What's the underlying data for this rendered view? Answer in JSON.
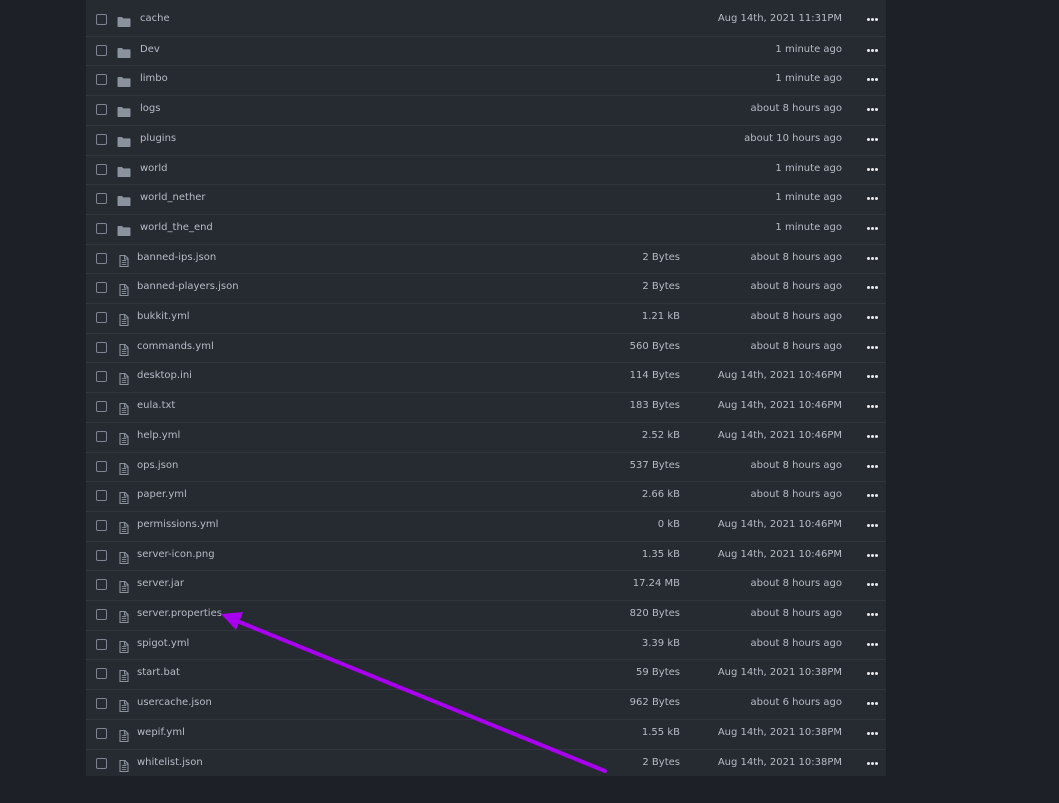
{
  "files": [
    {
      "type": "folder",
      "name": "cache",
      "size": "",
      "modified": "Aug 14th, 2021 11:31PM"
    },
    {
      "type": "folder",
      "name": "Dev",
      "size": "",
      "modified": "1 minute ago"
    },
    {
      "type": "folder",
      "name": "limbo",
      "size": "",
      "modified": "1 minute ago"
    },
    {
      "type": "folder",
      "name": "logs",
      "size": "",
      "modified": "about 8 hours ago"
    },
    {
      "type": "folder",
      "name": "plugins",
      "size": "",
      "modified": "about 10 hours ago"
    },
    {
      "type": "folder",
      "name": "world",
      "size": "",
      "modified": "1 minute ago"
    },
    {
      "type": "folder",
      "name": "world_nether",
      "size": "",
      "modified": "1 minute ago"
    },
    {
      "type": "folder",
      "name": "world_the_end",
      "size": "",
      "modified": "1 minute ago"
    },
    {
      "type": "file",
      "name": "banned-ips.json",
      "size": "2 Bytes",
      "modified": "about 8 hours ago"
    },
    {
      "type": "file",
      "name": "banned-players.json",
      "size": "2 Bytes",
      "modified": "about 8 hours ago"
    },
    {
      "type": "file",
      "name": "bukkit.yml",
      "size": "1.21 kB",
      "modified": "about 8 hours ago"
    },
    {
      "type": "file",
      "name": "commands.yml",
      "size": "560 Bytes",
      "modified": "about 8 hours ago"
    },
    {
      "type": "file",
      "name": "desktop.ini",
      "size": "114 Bytes",
      "modified": "Aug 14th, 2021 10:46PM"
    },
    {
      "type": "file",
      "name": "eula.txt",
      "size": "183 Bytes",
      "modified": "Aug 14th, 2021 10:46PM"
    },
    {
      "type": "file",
      "name": "help.yml",
      "size": "2.52 kB",
      "modified": "Aug 14th, 2021 10:46PM"
    },
    {
      "type": "file",
      "name": "ops.json",
      "size": "537 Bytes",
      "modified": "about 8 hours ago"
    },
    {
      "type": "file",
      "name": "paper.yml",
      "size": "2.66 kB",
      "modified": "about 8 hours ago"
    },
    {
      "type": "file",
      "name": "permissions.yml",
      "size": "0 kB",
      "modified": "Aug 14th, 2021 10:46PM"
    },
    {
      "type": "file",
      "name": "server-icon.png",
      "size": "1.35 kB",
      "modified": "Aug 14th, 2021 10:46PM"
    },
    {
      "type": "file",
      "name": "server.jar",
      "size": "17.24 MB",
      "modified": "about 8 hours ago"
    },
    {
      "type": "file",
      "name": "server.properties",
      "size": "820 Bytes",
      "modified": "about 8 hours ago"
    },
    {
      "type": "file",
      "name": "spigot.yml",
      "size": "3.39 kB",
      "modified": "about 8 hours ago"
    },
    {
      "type": "file",
      "name": "start.bat",
      "size": "59 Bytes",
      "modified": "Aug 14th, 2021 10:38PM"
    },
    {
      "type": "file",
      "name": "usercache.json",
      "size": "962 Bytes",
      "modified": "about 6 hours ago"
    },
    {
      "type": "file",
      "name": "wepif.yml",
      "size": "1.55 kB",
      "modified": "Aug 14th, 2021 10:38PM"
    },
    {
      "type": "file",
      "name": "whitelist.json",
      "size": "2 Bytes",
      "modified": "Aug 14th, 2021 10:38PM"
    }
  ],
  "icons": {
    "folder": "folder-icon",
    "file": "file-icon",
    "more": "more-options-icon",
    "checkbox": "checkbox"
  },
  "colors": {
    "background": "#1d2127",
    "panel": "#262a31",
    "row_divider": "#31363e",
    "text": "#b6bcc5",
    "icon": "#8a929e",
    "annotation_arrow": "#a800ee"
  }
}
